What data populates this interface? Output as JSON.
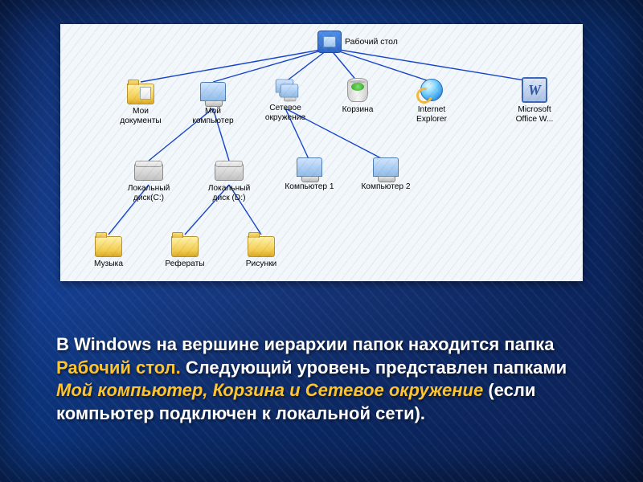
{
  "hierarchy": {
    "root": {
      "label": "Рабочий стол"
    },
    "level1": [
      {
        "id": "mydocs",
        "label": "Мои\nдокументы"
      },
      {
        "id": "mycomp",
        "label": "Мой\nкомпьютер"
      },
      {
        "id": "network",
        "label": "Сетевое\nокружение"
      },
      {
        "id": "recycle",
        "label": "Корзина"
      },
      {
        "id": "ie",
        "label": "Internet\nExplorer"
      },
      {
        "id": "word",
        "label": "Microsoft\nOffice W..."
      }
    ],
    "under_mycomp": [
      {
        "id": "diskc",
        "label": "Локальный\nдиск(С:)"
      },
      {
        "id": "diskd",
        "label": "Локальный\nдиск (D:)"
      }
    ],
    "under_network": [
      {
        "id": "pc1",
        "label": "Компьютер 1"
      },
      {
        "id": "pc2",
        "label": "Компьютер 2"
      }
    ],
    "under_diskc": [
      {
        "id": "music",
        "label": "Музыка"
      }
    ],
    "under_diskd": [
      {
        "id": "referat",
        "label": "Рефераты"
      },
      {
        "id": "pics",
        "label": "Рисунки"
      }
    ]
  },
  "caption": {
    "t1": "В Windows на вершине иерархии папок находится папка ",
    "h1": "Рабочий стол.",
    "t2": " Следующий уровень представлен папками ",
    "h2": "Мой компьютер, Корзина и Сетевое окружение",
    "t3": " (если компьютер подключен к локальной сети)."
  },
  "word_icon_letter": "W"
}
